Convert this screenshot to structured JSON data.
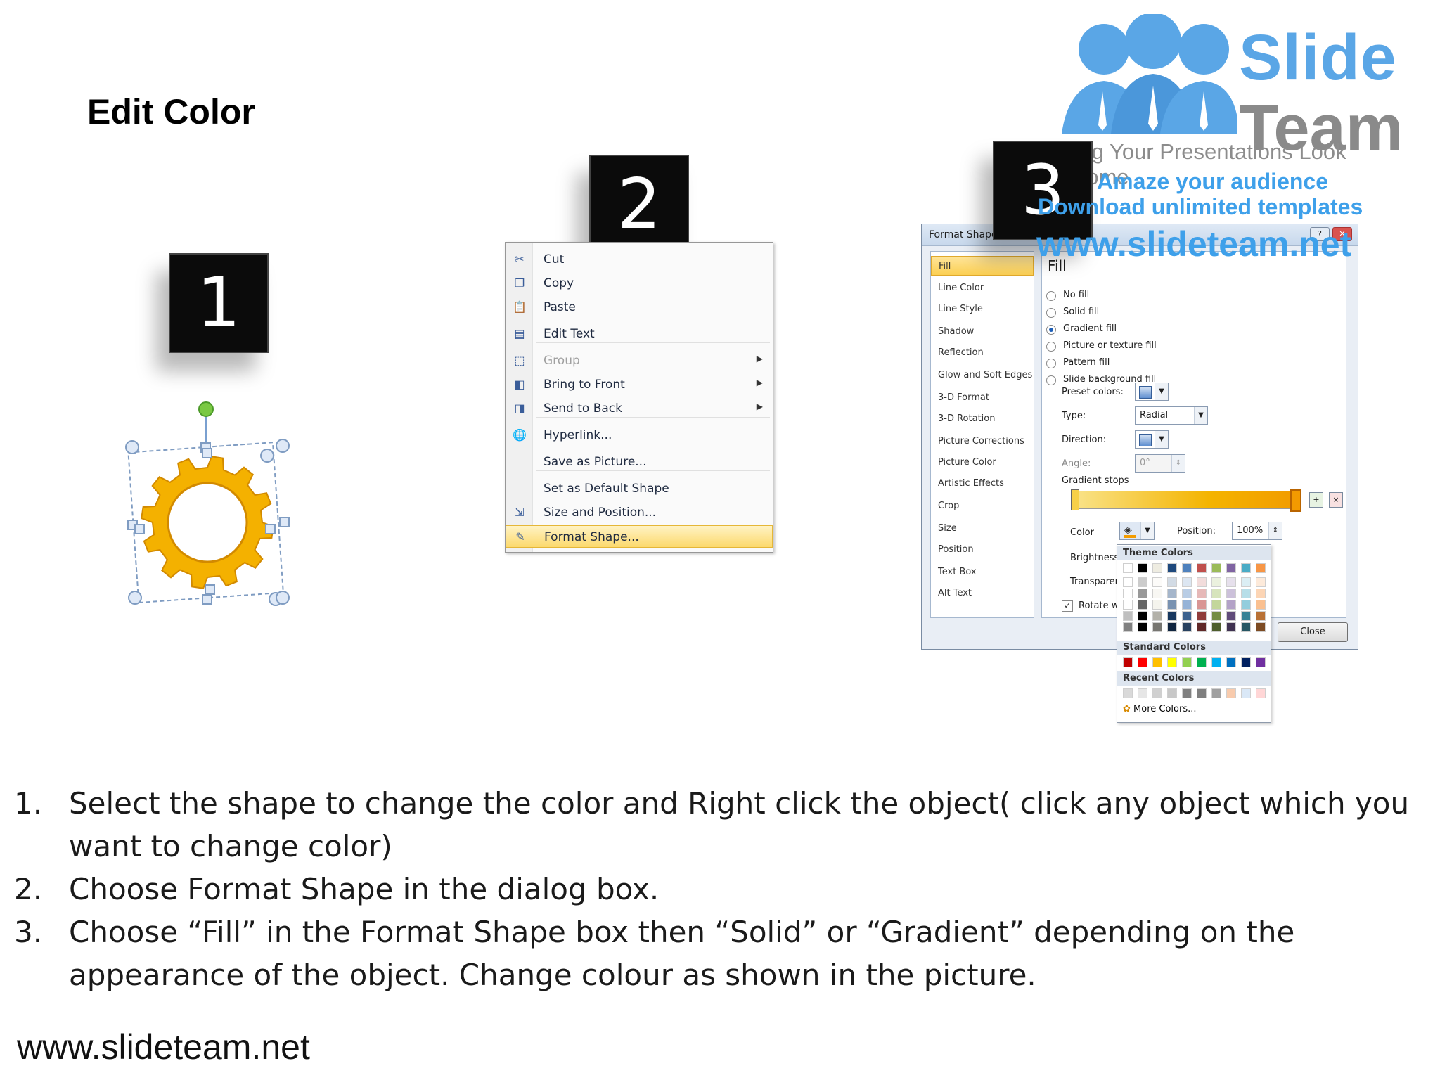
{
  "slide": {
    "title": "Edit Color",
    "footer": "www.slideteam.net",
    "badges": [
      "1",
      "2",
      "3"
    ]
  },
  "logo": {
    "line1": "Slide",
    "line2": "Team",
    "tagline": "Making Your Presentations Look Awesome",
    "amaze": "Amaze your audience",
    "download": "Download unlimited templates",
    "url": "www.slideteam.net",
    "colors": {
      "blue": "#5aa6e6",
      "gray": "#8a8a8a"
    }
  },
  "context_menu": {
    "items": [
      {
        "label": "Cut",
        "icon": "scissors-icon"
      },
      {
        "label": "Copy",
        "icon": "copy-icon"
      },
      {
        "label": "Paste",
        "icon": "paste-icon"
      },
      {
        "label": "Edit Text",
        "icon": "edit-text-icon"
      },
      {
        "label": "Group",
        "icon": "group-icon",
        "disabled": true
      },
      {
        "label": "Bring to Front",
        "icon": "bring-front-icon"
      },
      {
        "label": "Send to Back",
        "icon": "send-back-icon"
      },
      {
        "label": "Hyperlink...",
        "icon": "hyperlink-icon"
      },
      {
        "label": "Save as Picture...",
        "icon": ""
      },
      {
        "label": "Set as Default Shape",
        "icon": ""
      },
      {
        "label": "Size and Position...",
        "icon": "size-icon"
      },
      {
        "label": "Format Shape...",
        "icon": "format-shape-icon",
        "highlighted": true
      }
    ]
  },
  "dialog": {
    "title": "Format Shape",
    "close_label": "Close",
    "help_label": "?",
    "x_label": "✕",
    "sidebar": [
      "Fill",
      "Line Color",
      "Line Style",
      "Shadow",
      "Reflection",
      "Glow and Soft Edges",
      "3-D Format",
      "3-D Rotation",
      "Picture Corrections",
      "Picture Color",
      "Artistic Effects",
      "Crop",
      "Size",
      "Position",
      "Text Box",
      "Alt Text"
    ],
    "fill_heading": "Fill",
    "options": [
      "No fill",
      "Solid fill",
      "Gradient fill",
      "Picture or texture fill",
      "Pattern fill",
      "Slide background fill"
    ],
    "selected_option": "Gradient fill",
    "preset_colors_label": "Preset colors:",
    "type_label": "Type:",
    "type_value": "Radial",
    "direction_label": "Direction:",
    "angle_label": "Angle:",
    "angle_value": "0°",
    "gradient_stops_label": "Gradient stops",
    "color_label": "Color",
    "position_label": "Position:",
    "position_value": "100%",
    "brightness_label": "Brightness",
    "transparency_label": "Transparen",
    "rotate_label": "Rotate w"
  },
  "color_picker": {
    "theme_label": "Theme Colors",
    "standard_label": "Standard Colors",
    "recent_label": "Recent Colors",
    "more_label": "More Colors...",
    "theme_top": [
      "#ffffff",
      "#000000",
      "#eeece1",
      "#1f497d",
      "#4f81bd",
      "#c0504d",
      "#9bbb59",
      "#8064a2",
      "#4bacc6",
      "#f79646"
    ],
    "standard": [
      "#c00000",
      "#ff0000",
      "#ffc000",
      "#ffff00",
      "#92d050",
      "#00b050",
      "#00b0f0",
      "#0070c0",
      "#002060",
      "#7030a0"
    ],
    "recent": [
      "#d9d9d9",
      "#e6e6e6",
      "#d0d0d0",
      "#c8c8c8",
      "#808080",
      "#7f7f7f",
      "#a0a0a0",
      "#f8cbad",
      "#dae8f7",
      "#ffd6d6"
    ]
  },
  "instructions": [
    {
      "num": "1.",
      "text": "Select the shape to change the color and Right click the object( click any object which you want to change color)"
    },
    {
      "num": "2.",
      "text": "Choose Format Shape in the dialog box."
    },
    {
      "num": "3.",
      "text": "Choose “Fill” in the Format Shape box then “Solid” or “Gradient” depending on the appearance of the object. Change colour as shown in the picture."
    }
  ],
  "gear": {
    "color": "#f4b100",
    "edge_color": "#d28a00",
    "handle_color": "#7ac943"
  }
}
